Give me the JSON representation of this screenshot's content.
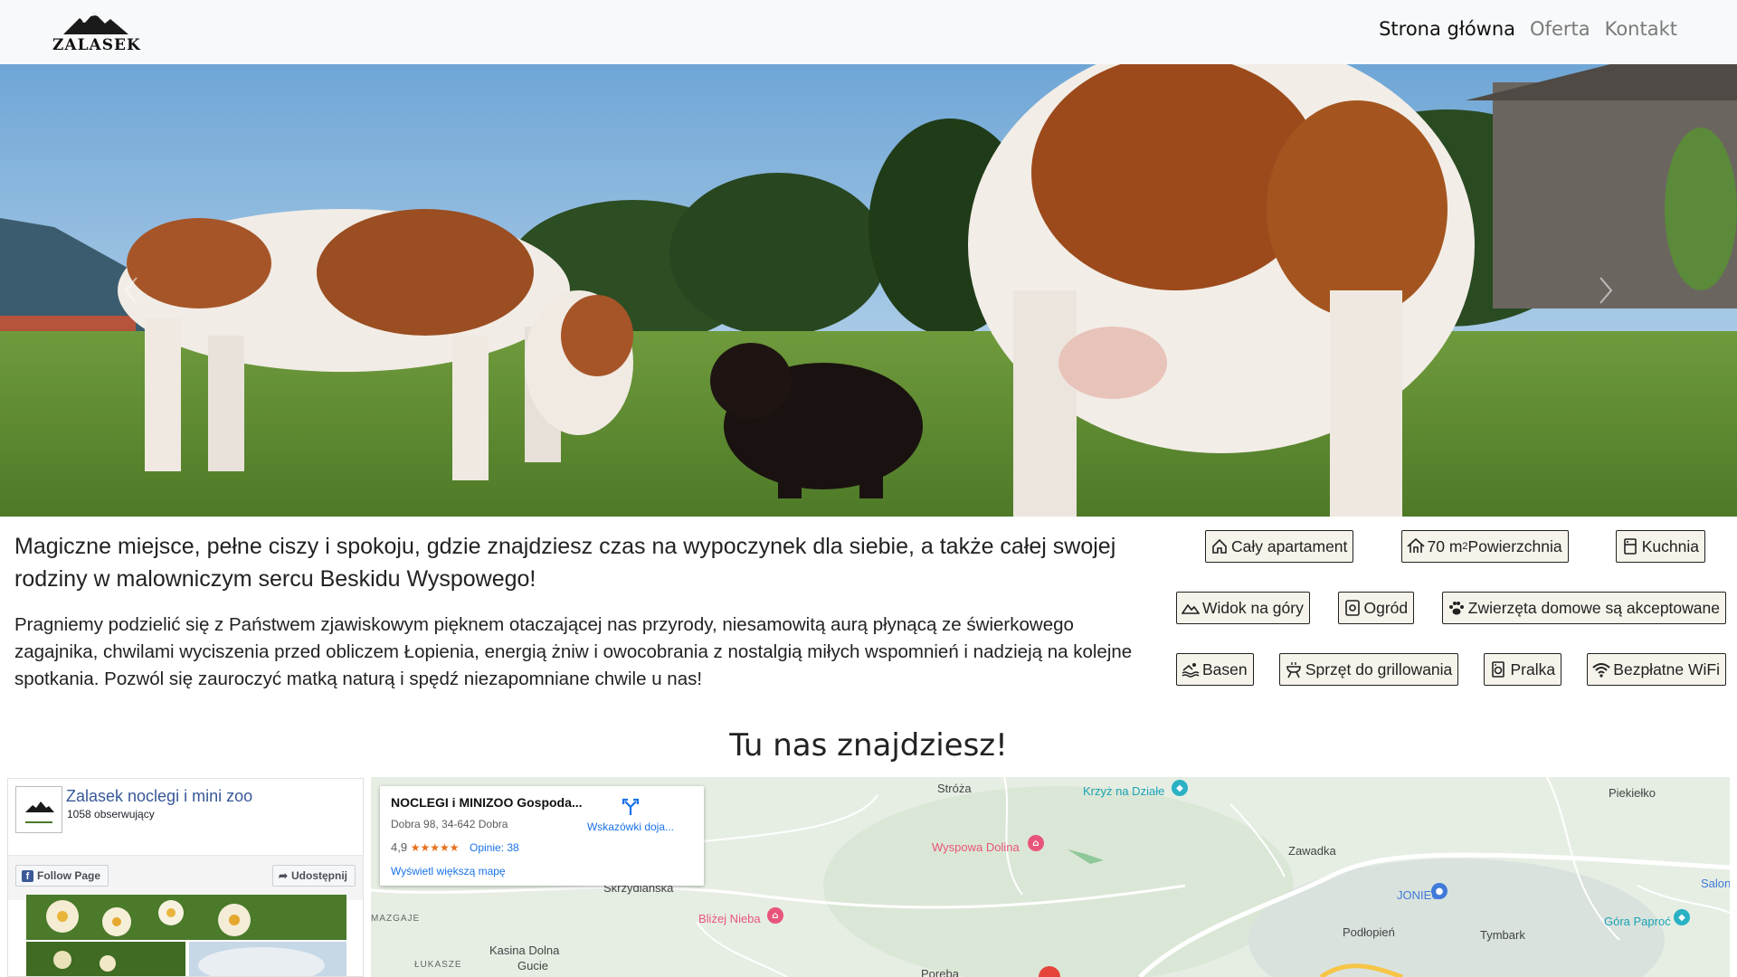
{
  "brand": {
    "logo_text": "ZALASEK"
  },
  "nav": {
    "items": [
      {
        "label": "Strona główna",
        "active": true
      },
      {
        "label": "Oferta",
        "active": false
      },
      {
        "label": "Kontakt",
        "active": false
      }
    ]
  },
  "intro": {
    "lead": "Magiczne miejsce, pełne ciszy i spokoju, gdzie znajdziesz czas na wypoczynek dla siebie, a także całej swojej rodziny w malowniczym sercu Beskidu Wyspowego!",
    "description": "Pragniemy podzielić się z Państwem zjawiskowym pięknem otaczającej nas przyrody, niesamowitą aurą płynącą ze świerkowego zagajnika, chwilami wyciszenia przed obliczem Łopienia, energią żniw i owocobrania z nostalgią miłych wspomnień i nadzieją na kolejne spotkania. Pozwól się zauroczyć matką naturą i spędź niezapomniane chwile u nas!"
  },
  "amenities": {
    "whole_apartment": "Cały apartament",
    "area_value": "70 m",
    "area_sup": "2",
    "area_label": " Powierzchnia",
    "kitchen": "Kuchnia",
    "mountain_view": "Widok na góry",
    "garden": "Ogród",
    "pets": "Zwierzęta domowe są akceptowane",
    "pool": "Basen",
    "grill": "Sprzęt do grillowania",
    "washer": "Pralka",
    "wifi": "Bezpłatne WiFi"
  },
  "location": {
    "title": "Tu nas znajdziesz!"
  },
  "facebook": {
    "page_name": "Zalasek noclegi i mini zoo",
    "followers": "1058 obserwujący",
    "follow_label": "Follow Page",
    "share_label": "Udostępnij",
    "avatar_text": "ZALASEK"
  },
  "map": {
    "place_name": "NOCLEGI i MINIZOO Gospoda...",
    "address": "Dobra 98, 34-642 Dobra",
    "rating": "4,9",
    "stars": "★★★★★",
    "reviews": "Opinie: 38",
    "directions": "Wskazówki doja...",
    "bigger_map": "Wyświetl większą mapę",
    "labels": {
      "stroza": "Stróża",
      "krzyz": "Krzyż na Działe",
      "piekielko": "Piekiełko",
      "wyspowa": "Wyspowa Dolina",
      "zawadka": "Zawadka",
      "skrzydlanska": "Skrzydlanska",
      "joniec": "JONIEC",
      "salon": "Salon",
      "blizej": "Bliżej Nieba",
      "gora": "Góra Paproć",
      "mazgaje": "MAZGAJE",
      "podlopien": "Podłopień",
      "tymbark": "Tymbark",
      "kasina": "Kasina Dolna",
      "gucie": "Gucie",
      "lukasze": "ŁUKASZE",
      "poreba": "Poręba"
    }
  },
  "colors": {
    "navbar_bg": "#f8f9fa",
    "amenity_bg": "#f5f3ea",
    "link_blue": "#385898",
    "map_blue": "#1a73e8",
    "poi_pink": "#e9557a",
    "poi_teal": "#2ab1c4"
  }
}
